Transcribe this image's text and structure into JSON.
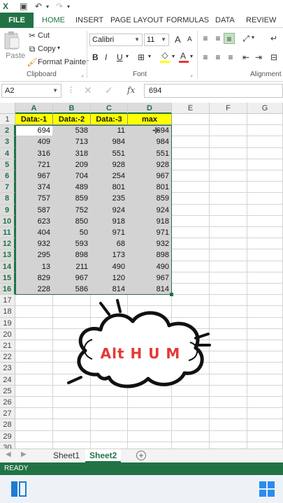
{
  "titlebar": {
    "undo_icon": "undo-icon",
    "redo_icon": "redo-icon",
    "customize_icon": "customize-icon"
  },
  "tabs": {
    "file": "FILE",
    "items": [
      "HOME",
      "INSERT",
      "PAGE LAYOUT",
      "FORMULAS",
      "DATA",
      "REVIEW"
    ],
    "active": "HOME"
  },
  "ribbon": {
    "clipboard": {
      "paste": "Paste",
      "cut": "Cut",
      "copy": "Copy",
      "format_painter": "Format Painter",
      "label": "Clipboard"
    },
    "font": {
      "name": "Calibri",
      "size": "11",
      "bold": "B",
      "italic": "I",
      "underline": "U",
      "label": "Font",
      "grow": "A",
      "shrink": "A",
      "font_color_glyph": "A"
    },
    "alignment": {
      "label": "Alignment"
    }
  },
  "formula_bar": {
    "name_box": "A2",
    "fx": "fx",
    "value": "694"
  },
  "grid": {
    "columns": [
      "A",
      "B",
      "C",
      "D",
      "E",
      "F",
      "G"
    ],
    "rows": [
      "1",
      "2",
      "3",
      "4",
      "5",
      "6",
      "7",
      "8",
      "9",
      "10",
      "11",
      "12",
      "13",
      "14",
      "15",
      "16",
      "17",
      "18",
      "19",
      "20",
      "21",
      "22",
      "23",
      "24",
      "25",
      "26",
      "27",
      "28",
      "29",
      "30"
    ],
    "headers": [
      "Data:-1",
      "Data:-2",
      "Data:-3",
      "max"
    ],
    "data": [
      [
        694,
        538,
        11,
        694
      ],
      [
        409,
        713,
        984,
        984
      ],
      [
        316,
        318,
        551,
        551
      ],
      [
        721,
        209,
        928,
        928
      ],
      [
        967,
        704,
        254,
        967
      ],
      [
        374,
        489,
        801,
        801
      ],
      [
        757,
        859,
        235,
        859
      ],
      [
        587,
        752,
        924,
        924
      ],
      [
        623,
        850,
        918,
        918
      ],
      [
        404,
        50,
        971,
        971
      ],
      [
        932,
        593,
        68,
        932
      ],
      [
        295,
        898,
        173,
        898
      ],
      [
        13,
        211,
        490,
        490
      ],
      [
        829,
        967,
        120,
        967
      ],
      [
        228,
        586,
        814,
        814
      ]
    ],
    "active_cell": "A2"
  },
  "overlay": {
    "text": "Alt H U M",
    "color": "#e53935"
  },
  "sheets": {
    "items": [
      "Sheet1",
      "Sheet2"
    ],
    "active": "Sheet2",
    "add": "+"
  },
  "status": {
    "text": "READY"
  },
  "colors": {
    "accent": "#217346",
    "header_fill": "#ffff00",
    "data_fill": "#d3d3d3"
  }
}
